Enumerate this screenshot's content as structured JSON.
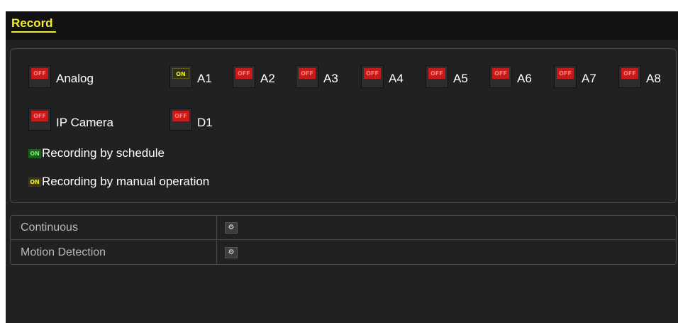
{
  "window": {
    "title": "Record"
  },
  "analog": {
    "label": "Analog",
    "master_state": "OFF",
    "channels": [
      {
        "name": "A1",
        "state": "ON"
      },
      {
        "name": "A2",
        "state": "OFF"
      },
      {
        "name": "A3",
        "state": "OFF"
      },
      {
        "name": "A4",
        "state": "OFF"
      },
      {
        "name": "A5",
        "state": "OFF"
      },
      {
        "name": "A6",
        "state": "OFF"
      },
      {
        "name": "A7",
        "state": "OFF"
      },
      {
        "name": "A8",
        "state": "OFF"
      }
    ]
  },
  "ip_camera": {
    "label": "IP Camera",
    "master_state": "OFF",
    "channels": [
      {
        "name": "D1",
        "state": "OFF"
      }
    ]
  },
  "legend": {
    "schedule_badge": "ON",
    "schedule_label": "Recording by schedule",
    "manual_badge": "ON",
    "manual_label": "Recording by manual operation"
  },
  "record_types": [
    {
      "name": "Continuous",
      "button_icon": "gear-icon"
    },
    {
      "name": "Motion Detection",
      "button_icon": "gear-icon"
    }
  ],
  "colors": {
    "accent": "#f2ea2a",
    "off_indicator": "#c71b1b",
    "on_indicator": "#f3f02a",
    "schedule_indicator": "#6cf06c",
    "background": "#212121"
  }
}
